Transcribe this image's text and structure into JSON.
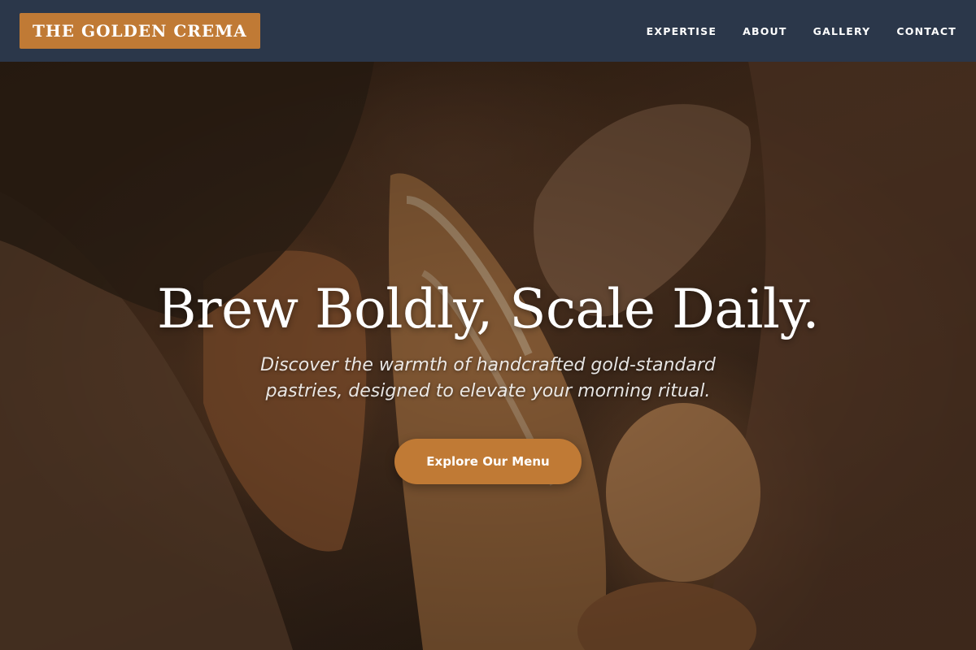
{
  "brand": {
    "name": "THE GOLDEN CREMA"
  },
  "nav": {
    "items": [
      "EXPERTISE",
      "ABOUT",
      "GALLERY",
      "CONTACT"
    ]
  },
  "hero": {
    "headline": "Brew Boldly, Scale Daily.",
    "subtitle": "Discover the warmth of handcrafted gold-standard pastries, designed to elevate your morning ritual.",
    "cta_label": "Explore Our Menu"
  },
  "colors": {
    "navbar": "#2b374a",
    "accent": "#c07a35",
    "text": "#ffffff"
  }
}
